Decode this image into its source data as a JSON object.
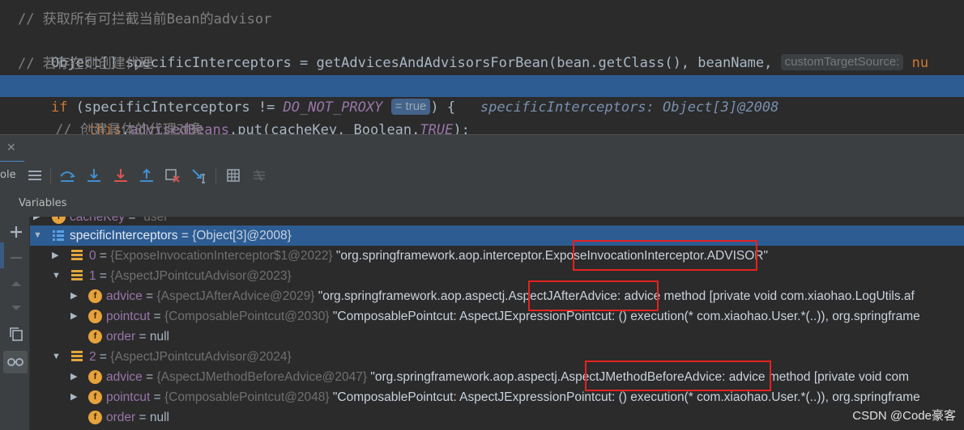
{
  "editor": {
    "line1": "// 获取所有可拦截当前Bean的advisor",
    "line2_code": "Object[] specificInterceptors = getAdvicesAndAdvisorsForBean(bean.getClass(), beanName,",
    "line2_hint": "customTargetSource:",
    "line2_hint_tail": "nu",
    "line3": "// 若存在则创建代理",
    "line4_kw": "if",
    "line4_a": " (specificInterceptors != ",
    "line4_const": "DO_NOT_PROXY",
    "line4_hint": "= true",
    "line4_b": ") {",
    "line4_inline": "specificInterceptors: Object[3]@2008",
    "line5_kw": "this",
    "line5_a": ".",
    "line5_field": "advisedBeans",
    "line5_b": ".put(cacheKey, Boolean.",
    "line5_const": "TRUE",
    "line5_c": ");",
    "line6": "// 创建具体的代理对象"
  },
  "toolbar": {
    "left_fragment": "ole"
  },
  "variables": {
    "title": "Variables",
    "rows": [
      {
        "name": "cacheKey",
        "eq": " = ",
        "value": "\"user\""
      },
      {
        "name": "specificInterceptors",
        "eq": " = ",
        "ref": "{Object[3]@2008}"
      },
      {
        "name": "0",
        "eq": " = ",
        "ref": "{ExposeInvocationInterceptor$1@2022}",
        "str_pre": " \"org.springframework.aop.intercepto",
        "str_hl": "r.ExposeInvocationInterceptor.",
        "str_post": "ADVISOR\""
      },
      {
        "name": "1",
        "eq": " = ",
        "ref": "{AspectJPointcutAdvisor@2023}"
      },
      {
        "name": "advice",
        "eq": " = ",
        "ref": "{AspectJAfterAdvice@2029}",
        "str_pre": " \"org.springframework.aop.aspect",
        "str_hl": "j.AspectJAfterAdvice:",
        "str_post": " advice method [private void com.xiaohao.LogUtils.af"
      },
      {
        "name": "pointcut",
        "eq": " = ",
        "ref": "{ComposablePointcut@2030}",
        "str_pre": " \"ComposablePointcut: AspectJExpressionPointcut: () execution(* com.xiaohao.User.*(..)), org.springframe",
        "str_hl": "",
        "str_post": ""
      },
      {
        "name": "order",
        "eq": " = ",
        "value": "null"
      },
      {
        "name": "2",
        "eq": " = ",
        "ref": "{AspectJPointcutAdvisor@2024}"
      },
      {
        "name": "advice",
        "eq": " = ",
        "ref": "{AspectJMethodBeforeAdvice@2047}",
        "str_pre": " \"org.springframework.aop.aspect",
        "str_hl": "j.AspectJMethodBeforeAdvice:",
        "str_post": " advice method [private void com"
      },
      {
        "name": "pointcut",
        "eq": " = ",
        "ref": "{ComposablePointcut@2048}",
        "str_pre": " \"ComposablePointcut: AspectJExpressionPointcut: () execution(* com.xiaohao.User.*(..)), org.springframe",
        "str_hl": "",
        "str_post": ""
      },
      {
        "name": "order",
        "eq": " = ",
        "value": "null"
      }
    ]
  },
  "watermark": "CSDN @Code豪客",
  "colors": {
    "selection": "#2d5c93",
    "highlight_box": "#e5231e",
    "field_icon": "#e6a23c"
  },
  "icons": [
    "close-icon",
    "restore-layout-icon",
    "step-over-icon",
    "step-into-icon",
    "force-step-into-icon",
    "step-out-icon",
    "drop-frame-icon",
    "run-to-cursor-icon",
    "evaluate-icon",
    "trace-icon",
    "add-watch-icon",
    "remove-watch-icon",
    "copy-icon",
    "glasses-icon"
  ]
}
